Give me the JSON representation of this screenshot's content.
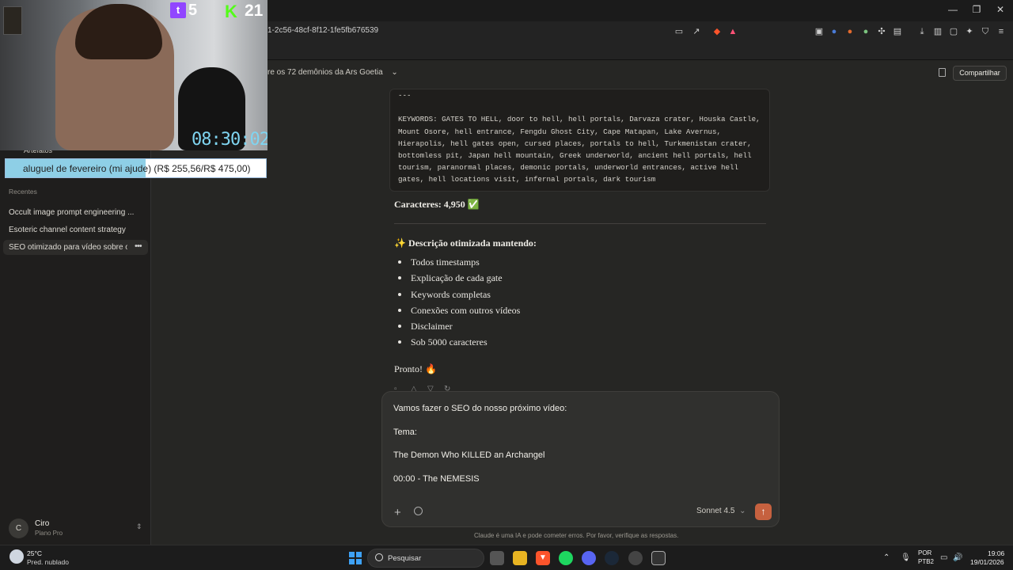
{
  "browser": {
    "url": "1-2c56-48cf-8f12-1fe5fb676539",
    "controls": {
      "minimize": "—",
      "restore": "❐",
      "close": "✕"
    }
  },
  "header": {
    "title": "re os 72 demônios da Ars Goetia",
    "share_label": "Compartilhar"
  },
  "message": {
    "code_text": "---\n\nKEYWORDS: GATES TO HELL, door to hell, hell portals, Darvaza crater, Houska Castle, Mount Osore, hell entrance, Fengdu Ghost City, Cape Matapan, Lake Avernus, Hierapolis, hell gates open, cursed places, portals to hell, Turkmenistan crater, bottomless pit, Japan hell mountain, Greek underworld, ancient hell portals, hell tourism, paranormal places, demonic portals, underworld entrances, active hell gates, hell locations visit, infernal portals, dark tourism",
    "char_count": "Caracteres: 4,950 ✅",
    "desc_title": "✨ Descrição otimizada mantendo:",
    "bullets": [
      "Todos timestamps",
      "Explicação de cada gate",
      "Keywords completas",
      "Conexões com outros vídeos",
      "Disclaimer",
      "Sob 5000 caracteres"
    ],
    "done": "Pronto! 🔥"
  },
  "input": {
    "line1": "Vamos fazer o SEO do nosso próximo vídeo:",
    "line2": "Tema:",
    "line3": "The Demon Who KILLED an Archangel",
    "line4": "00:00 -  The NEMESIS",
    "model": "Sonnet 4.5",
    "disclaimer": "Claude é uma IA e pode cometer erros. Por favor, verifique as respostas."
  },
  "sidebar": {
    "artifacts_label": "Artefatos",
    "recents_label": "Recentes",
    "recents": [
      "Occult image prompt engineering ...",
      "Esoteric channel content strategy",
      "SEO otimizado para vídeo sobre o..."
    ],
    "user": {
      "initial": "C",
      "name": "Ciro",
      "plan": "Plano Pro"
    }
  },
  "stream_overlay": {
    "twitch_viewers": "5",
    "kick_viewers": "21",
    "timer": "08:30:02",
    "goal_text": "aluguel de fevereiro (mi ajude) (R$ 255,56/R$ 475,00)",
    "goal_progress": 0.538,
    "twitch_color": "#9146ff",
    "kick_color": "#53fc18"
  },
  "taskbar": {
    "weather_temp": "25°C",
    "weather_desc": "Pred. nublado",
    "search_placeholder": "Pesquisar",
    "lang1": "POR",
    "lang2": "PTB2",
    "time": "19:06",
    "date": "19/01/2026"
  },
  "accent": "#c6613f"
}
